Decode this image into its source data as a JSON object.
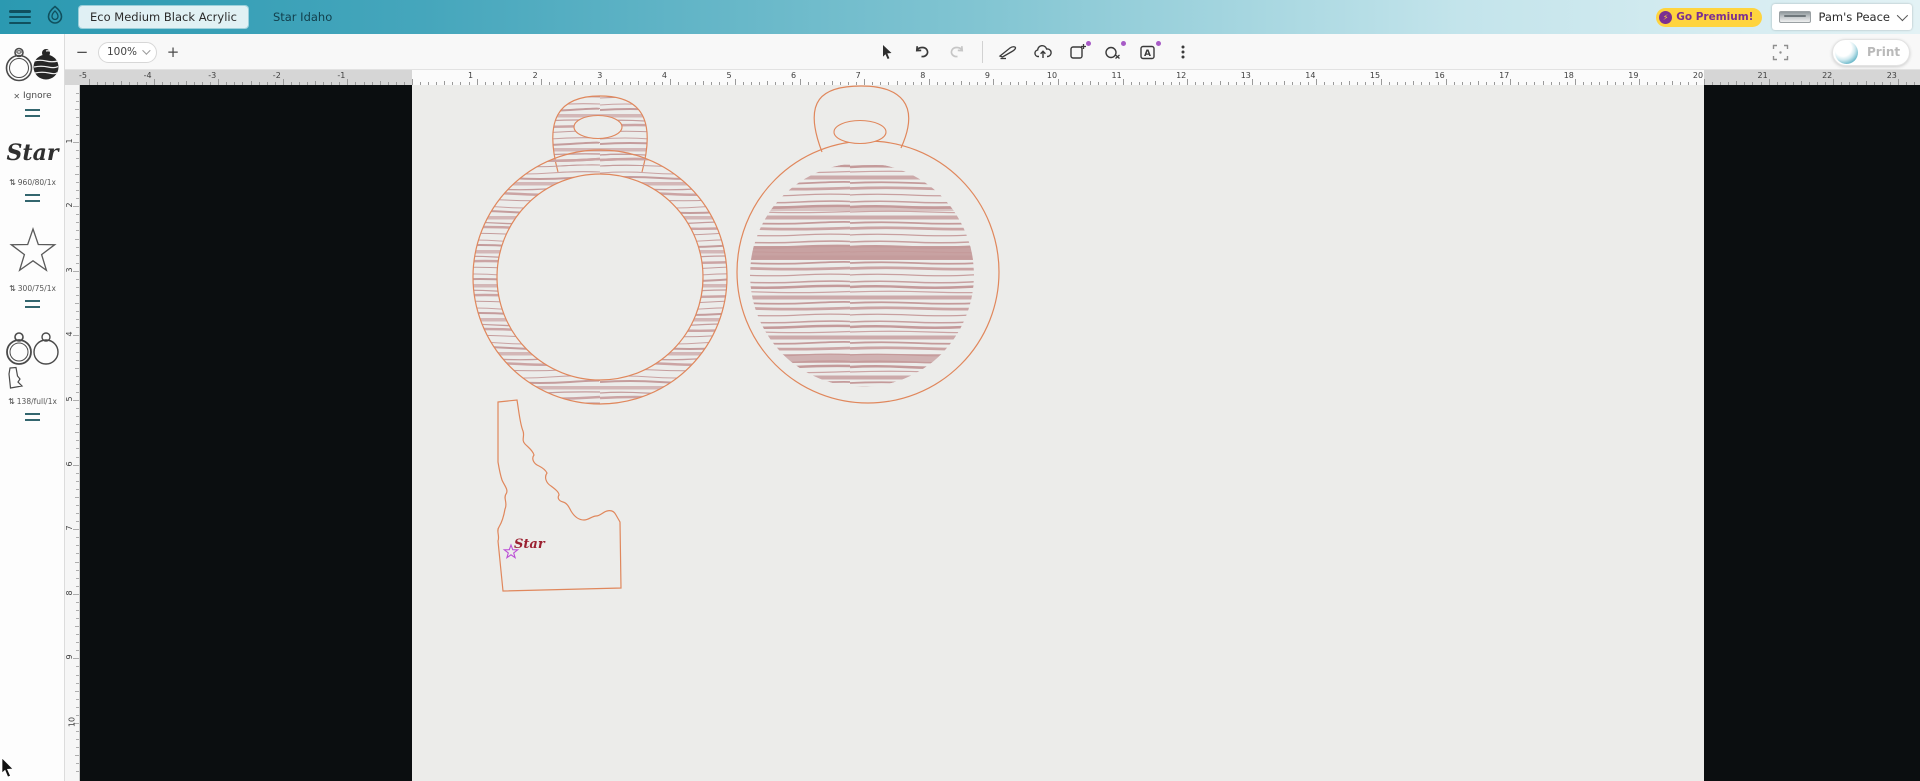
{
  "topbar": {
    "tabs": [
      {
        "label": "Eco Medium Black Acrylic",
        "selected": true
      },
      {
        "label": "Star Idaho",
        "selected": false
      }
    ],
    "premium": {
      "label": "Go Premium!",
      "bolt_glyph": "⚡"
    },
    "user": {
      "name": "Pam's Peace"
    }
  },
  "toolbar": {
    "zoom_out_glyph": "−",
    "zoom_level": "100%",
    "zoom_in_glyph": "+",
    "text_tool_glyph": "A",
    "print": {
      "label": "Print",
      "enabled": false
    }
  },
  "sidebar": {
    "settings_icon_glyph": "⇅",
    "steps": [
      {
        "type": "ignore",
        "action_label": "Ignore",
        "icon_glyph": "✕"
      },
      {
        "type": "engrave",
        "thumbnail_text": "Star",
        "settings": "960/80/1x"
      },
      {
        "type": "engrave",
        "settings": "300/75/1x"
      },
      {
        "type": "cut",
        "settings": "138/full/1x"
      }
    ]
  },
  "rulers": {
    "unit": "in",
    "h_labels": [
      -5,
      -4,
      -3,
      -2,
      -1,
      1,
      2,
      3,
      4,
      5,
      6,
      7,
      8,
      9,
      10,
      11,
      12,
      13,
      14,
      15,
      16,
      17,
      18,
      19,
      20,
      21,
      22,
      23
    ],
    "v_labels": [
      1,
      2,
      3,
      4,
      5,
      6,
      7,
      8,
      9,
      10
    ]
  },
  "canvas": {
    "artwork": {
      "state_text": "Star",
      "colors": {
        "cut_outline": "#e0875c",
        "engrave_grain": "#c49c9c",
        "state_text_color": "#9b2030",
        "star_outline": "#bb4fd6"
      }
    }
  }
}
